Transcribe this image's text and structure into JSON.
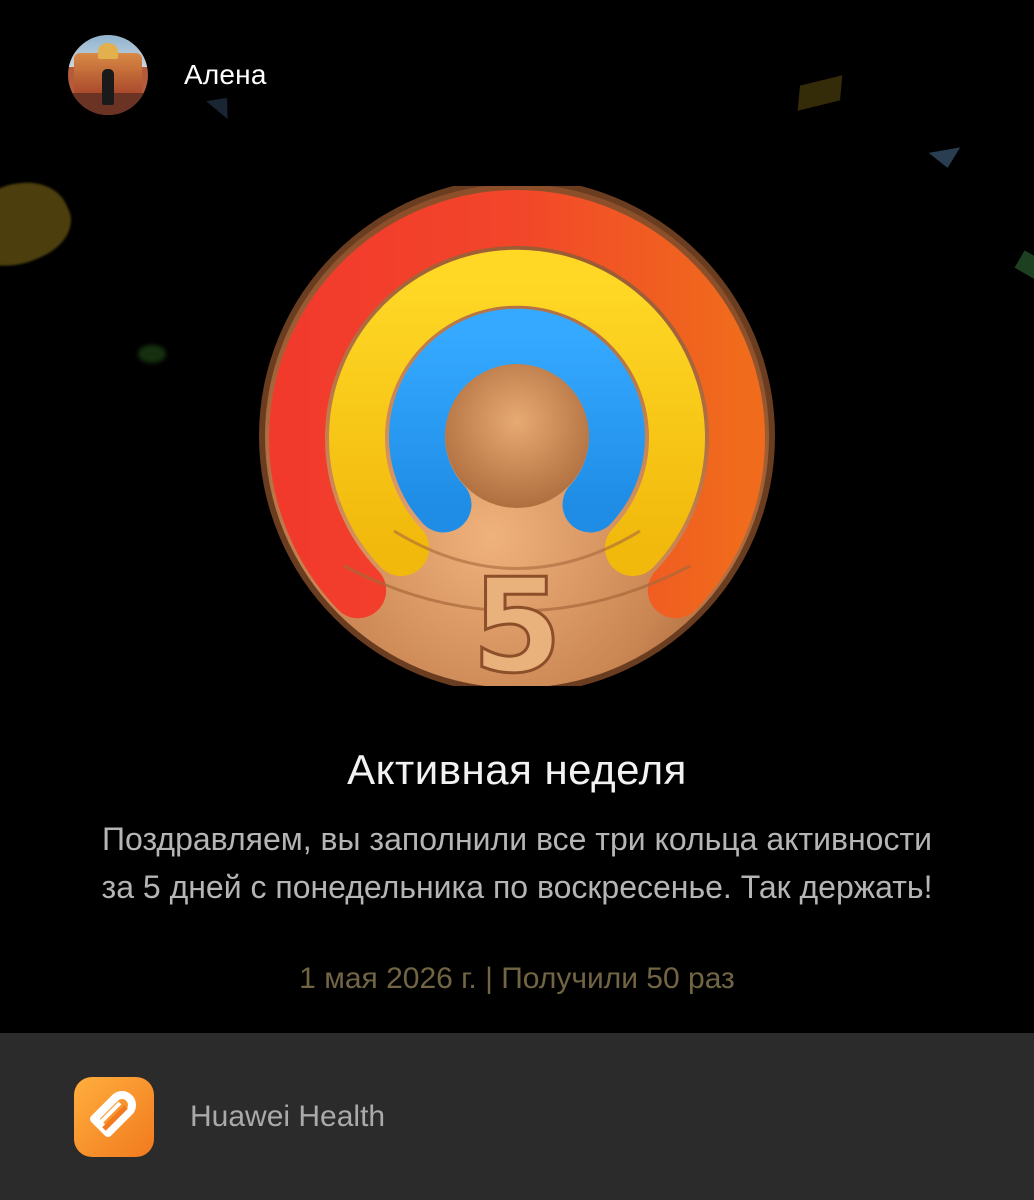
{
  "user": {
    "name": "Алена"
  },
  "achievement": {
    "badge_number": "5",
    "title": "Активная неделя",
    "description_line1": "Поздравляем, вы заполнили все три кольца активности",
    "description_line2": "за 5 дней с понедельника по воскресенье. Так держать!",
    "meta": "1 мая 2026 г. | Получили 50 раз"
  },
  "source_app": {
    "name": "Huawei Health",
    "icon": "huawei-health-icon"
  },
  "colors": {
    "background": "#000000",
    "footer": "#2b2b2b",
    "ring_red": "#f0302a",
    "ring_orange": "#f26a1f",
    "ring_yellow": "#f5c814",
    "ring_blue": "#2a9df4",
    "medal_gold": "#c88a55",
    "meta_text": "#726544"
  }
}
